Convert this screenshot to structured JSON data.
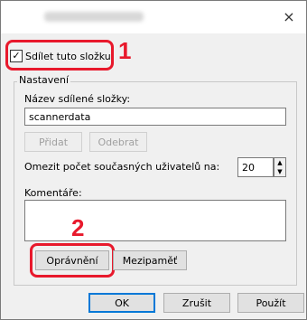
{
  "dialog": {
    "close_glyph": "×"
  },
  "share": {
    "checkbox_label": "Sdílet tuto složku",
    "checked": true,
    "callout_1": "1"
  },
  "settings": {
    "group_label": "Nastavení",
    "share_name_label": "Název sdílené složky:",
    "share_name_value": "scannerdata",
    "add_button": "Přidat",
    "remove_button": "Odebrat",
    "limit_label": "Omezit počet současných uživatelů na:",
    "limit_value": "20",
    "comments_label": "Komentáře:",
    "comments_value": "",
    "callout_2": "2",
    "permissions_button": "Oprávnění",
    "caching_button": "Mezipaměť"
  },
  "footer": {
    "ok_button": "OK",
    "cancel_button": "Zrušit",
    "apply_button": "Použít"
  },
  "colors": {
    "highlight": "#e8192c",
    "focus": "#0078d7"
  }
}
